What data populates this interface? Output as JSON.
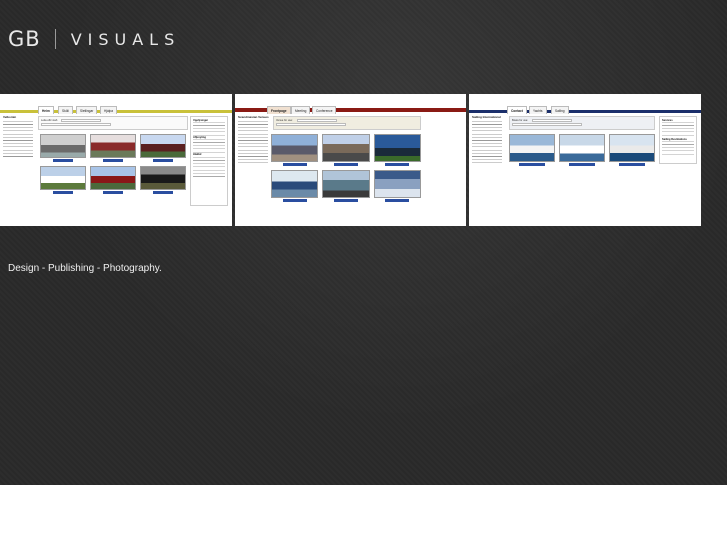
{
  "logo": {
    "left": "GB",
    "right": "VISUALS"
  },
  "tagline": "Design - Publishing - Photography.",
  "colors": {
    "thumb1_bar": "#c9c13a",
    "thumb2_bar": "#8a1a14",
    "thumb3_bar": "#1b2f6b"
  },
  "thumbnails": [
    {
      "tabs": [
        "Heim",
        "Sköli",
        "Sletlingar",
        "Hjálpa"
      ],
      "sidebar_title": "Velkomin",
      "search_label": "Leita eftir stað",
      "right_titles": [
        "Upplýsingar",
        "Afþreyting",
        "Hlekkir"
      ]
    },
    {
      "tabs": [
        "Frontpage",
        "Meeting",
        "Conference"
      ],
      "sidebar_title": "Scandinavian Venues",
      "search_label": "Venue for use:",
      "right_titles": []
    },
    {
      "tabs": [
        "Contact",
        "Yachts",
        "Sailing"
      ],
      "sidebar_title": "Sailing International",
      "search_label": "Boats for use:",
      "right_titles": [
        "Services",
        "Sailing Destinations"
      ]
    }
  ]
}
